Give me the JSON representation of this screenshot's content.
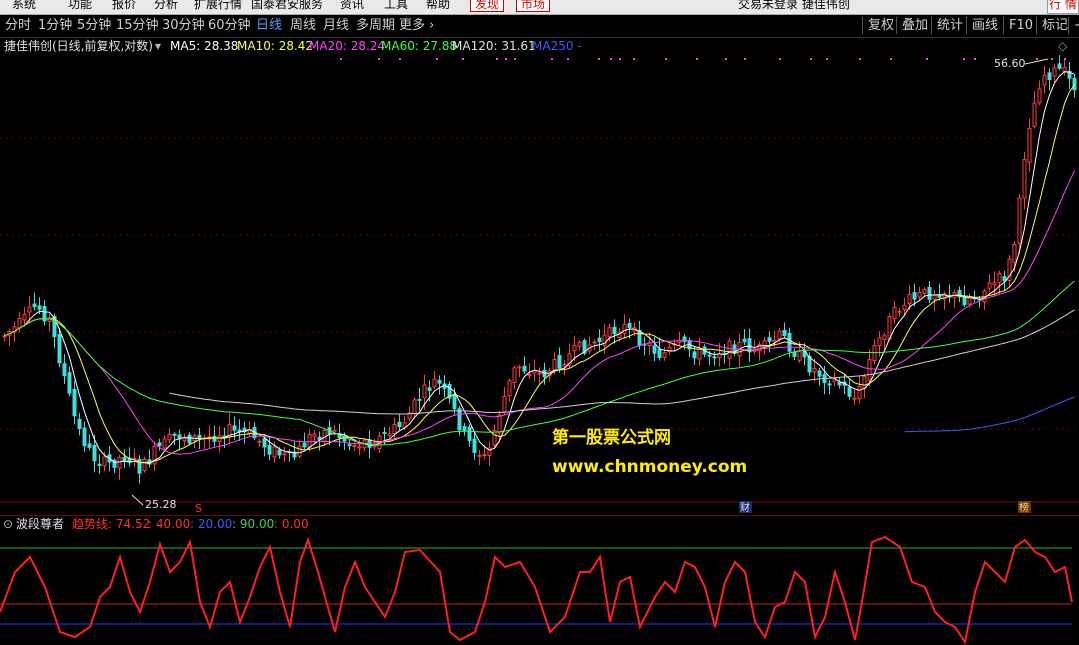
{
  "menubar": {
    "items": [
      "系统",
      "功能",
      "报价",
      "分析",
      "扩展行情",
      "国泰君安服务",
      "资讯",
      "工具",
      "帮助"
    ],
    "highlight": [
      "发现",
      "市场"
    ],
    "right_text": "交易未登录  捷佳伟创",
    "corner": "行 情"
  },
  "period_tabs": [
    "分时",
    "1分钟",
    "5分钟",
    "15分钟",
    "30分钟",
    "60分钟",
    "日线",
    "周线",
    "月线",
    "多周期",
    "更多 ›"
  ],
  "active_period": "日线",
  "right_buttons": [
    "复权",
    "叠加",
    "统计",
    "画线",
    "F10",
    "标记",
    "+"
  ],
  "info": {
    "title": "捷佳伟创(日线,前复权,对数)",
    "ma5": "MA5: 28.38",
    "ma10": "MA10: 28.42",
    "ma20": "MA20: 28.24",
    "ma60": "MA60: 27.88",
    "ma120": "MA120: 31.61",
    "ma250": "MA250 -"
  },
  "price_labels": {
    "high": "56.60",
    "low": "25.28"
  },
  "markers": {
    "s": "S",
    "cai": "财",
    "bang": "榜"
  },
  "watermark": {
    "line1": "第一股票公式网",
    "line2": "www.chnmoney.com"
  },
  "indicator": {
    "name": "波段尊者",
    "label": "趋势线: 74.52",
    "v1": ": 40.00",
    "v2": ": 20.00",
    "v3": ": 90.00",
    "v4": ": 0.00"
  },
  "colors": {
    "up": "#ff3b3b",
    "down": "#40e0e0",
    "ma5": "#ffffff",
    "ma10": "#ffff40",
    "ma20": "#ff40ff",
    "ma60": "#40ff40",
    "ma120": "#d0d0d0",
    "ma250": "#3a5bff"
  },
  "chart_data": {
    "type": "candlestick",
    "series": [
      {
        "name": "MA5",
        "values": [
          28.38
        ]
      },
      {
        "name": "MA10",
        "values": [
          28.42
        ]
      },
      {
        "name": "MA20",
        "values": [
          28.24
        ]
      },
      {
        "name": "MA60",
        "values": [
          27.88
        ]
      },
      {
        "name": "MA120",
        "values": [
          31.61
        ]
      }
    ],
    "price_high": 56.6,
    "price_low": 25.28,
    "indicator_levels": [
      40,
      20,
      90,
      0
    ],
    "indicator_last": 74.52
  }
}
